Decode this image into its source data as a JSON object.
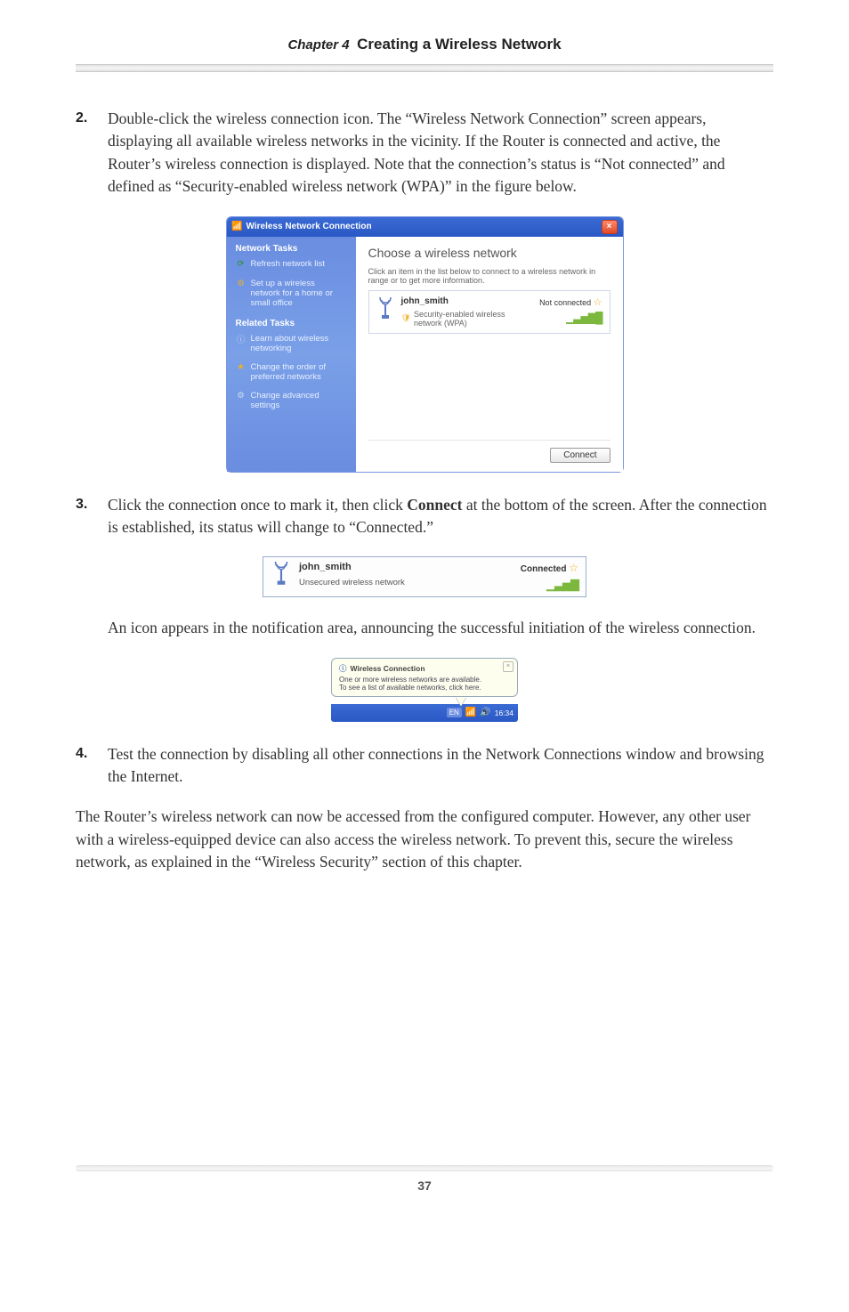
{
  "header": {
    "chapter_label": "Chapter 4",
    "chapter_title": "Creating a Wireless Network"
  },
  "steps": {
    "s2": {
      "num": "2.",
      "text": "Double-click the wireless connection icon. The “Wireless Network Connection” screen appears, displaying all available wireless networks in the vicinity. If the Router is connected and active, the Router’s wireless connection is displayed. Note that the connection’s status is “Not connected” and defined as “Security-enabled wireless network (WPA)” in the figure below."
    },
    "s3": {
      "num": "3.",
      "pre": "Click the connection once to mark it, then click ",
      "bold": "Connect",
      "post": " at the bottom of the screen. After the connection is established, its status will change to “Connected.”"
    },
    "s3b": "An icon appears in the notification area, announcing the successful initiation of the wireless connection.",
    "s4": {
      "num": "4.",
      "text": "Test the connection by disabling all other connections in the Network Connections window and browsing the Internet."
    }
  },
  "closing": "The Router’s wireless network can now be accessed from the configured computer. However, any other user with a wireless-equipped device can also access the wireless network. To prevent this, secure the wireless network, as explained in the “Wireless Security” section of this chapter.",
  "dlg1": {
    "title": "Wireless Network Connection",
    "side": {
      "sec1_hd": "Network Tasks",
      "refresh": "Refresh network list",
      "setup": "Set up a wireless network for a home or small office",
      "sec2_hd": "Related Tasks",
      "learn": "Learn about wireless networking",
      "order": "Change the order of preferred networks",
      "adv": "Change advanced settings"
    },
    "main": {
      "heading": "Choose a wireless network",
      "hint": "Click an item in the list below to connect to a wireless network in range or to get more information.",
      "net_name": "john_smith",
      "net_sub": "Security-enabled wireless network (WPA)",
      "status": "Not connected",
      "connect_btn": "Connect"
    }
  },
  "dlg2": {
    "name": "john_smith",
    "sub": "Unsecured wireless network",
    "status": "Connected"
  },
  "dlg3": {
    "title": "Wireless Connection",
    "line1": "One or more wireless networks are available.",
    "line2": "To see a list of available networks, click here.",
    "lang": "EN",
    "clock": "16:34"
  },
  "page_number": "37"
}
